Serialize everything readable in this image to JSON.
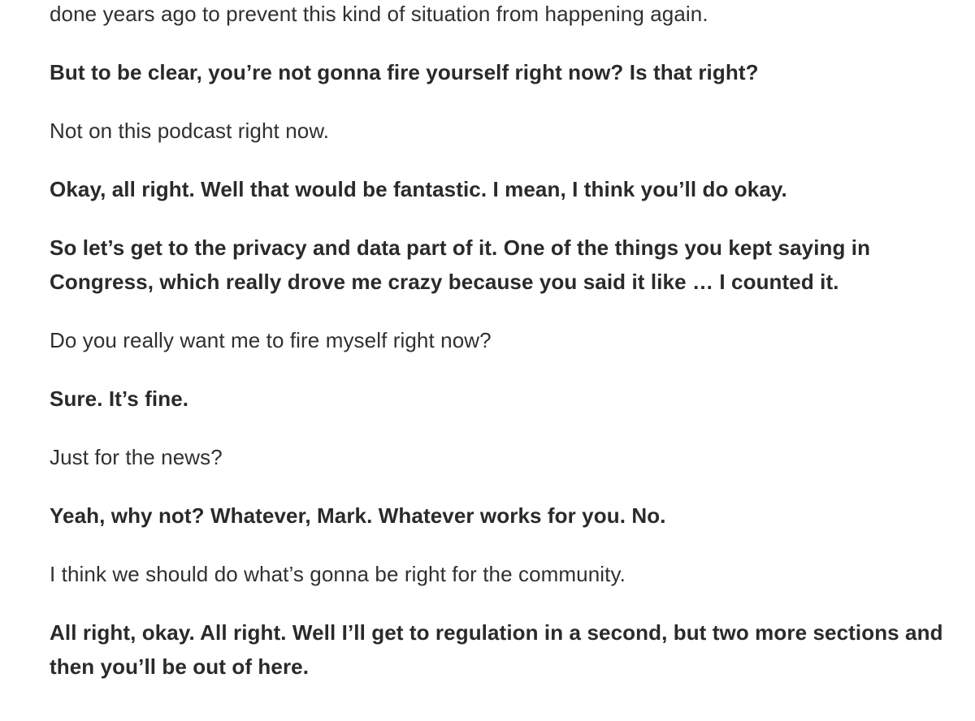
{
  "transcript": {
    "lines": [
      {
        "speaker": "answer",
        "text": "done years ago to prevent this kind of situation from happening again."
      },
      {
        "speaker": "question",
        "text": "But to be clear, you’re not gonna fire yourself right now? Is that right?"
      },
      {
        "speaker": "answer",
        "text": "Not on this podcast right now."
      },
      {
        "speaker": "question",
        "text": "Okay, all right. Well that would be fantastic. I mean, I think you’ll do okay."
      },
      {
        "speaker": "question",
        "text": "So let’s get to the privacy and data part of it. One of the things you kept saying in Congress, which really drove me crazy because you said it like … I counted it."
      },
      {
        "speaker": "answer",
        "text": "Do you really want me to fire myself right now?"
      },
      {
        "speaker": "question",
        "text": "Sure. It’s fine."
      },
      {
        "speaker": "answer",
        "text": "Just for the news?"
      },
      {
        "speaker": "question",
        "text": "Yeah, why not? Whatever, Mark. Whatever works for you. No."
      },
      {
        "speaker": "answer",
        "text": "I think we should do what’s gonna be right for the community."
      },
      {
        "speaker": "question",
        "text": "All right, okay. All right. Well I’ll get to regulation in a second, but two more sections and then you’ll be out of here."
      }
    ]
  }
}
